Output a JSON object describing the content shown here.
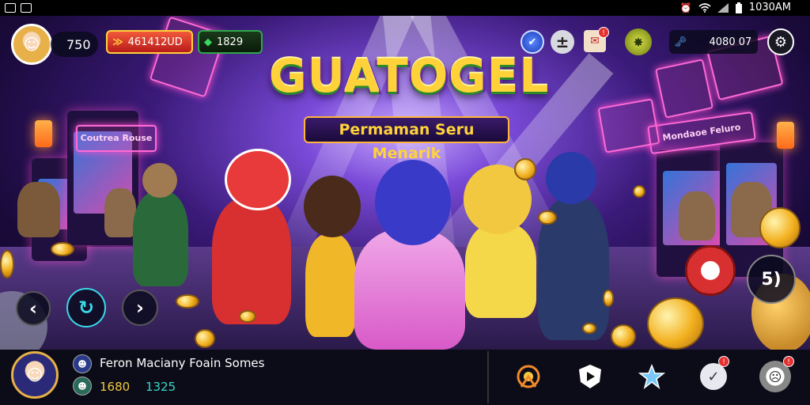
{
  "statusbar": {
    "time": "1030AM"
  },
  "hud": {
    "level": "750",
    "currency_primary": "461412UD",
    "currency_gem": "1829",
    "currency_right": "4080 07"
  },
  "title": {
    "main": "GUATOGEL",
    "subtitle": "Permaman Seru Menarik"
  },
  "scene": {
    "sign_left": "Coutrea Rouse",
    "sign_right": "Mondaoe Feluro"
  },
  "nav": {
    "left_symbol": "‹",
    "replay_symbol": "↻",
    "right_symbol": "›",
    "corner_label": "5)"
  },
  "bottom": {
    "feed_text": "Feron Maciany Foain Somes",
    "stat_a": "1680",
    "stat_b": "1325"
  },
  "colors": {
    "gold": "#f2b01e",
    "accent_pink": "#ff4fd0",
    "green_button": "#2ea84a",
    "red_button": "#d83030",
    "badge_red": "#e53030"
  },
  "icons": {
    "top": [
      "globe-icon",
      "plus-icon",
      "mail-icon",
      "gem-icon",
      "key-icon",
      "gear-icon"
    ],
    "bottom": [
      "target-icon",
      "shield-play-icon",
      "star-icon",
      "check-icon",
      "profile-icon"
    ]
  }
}
